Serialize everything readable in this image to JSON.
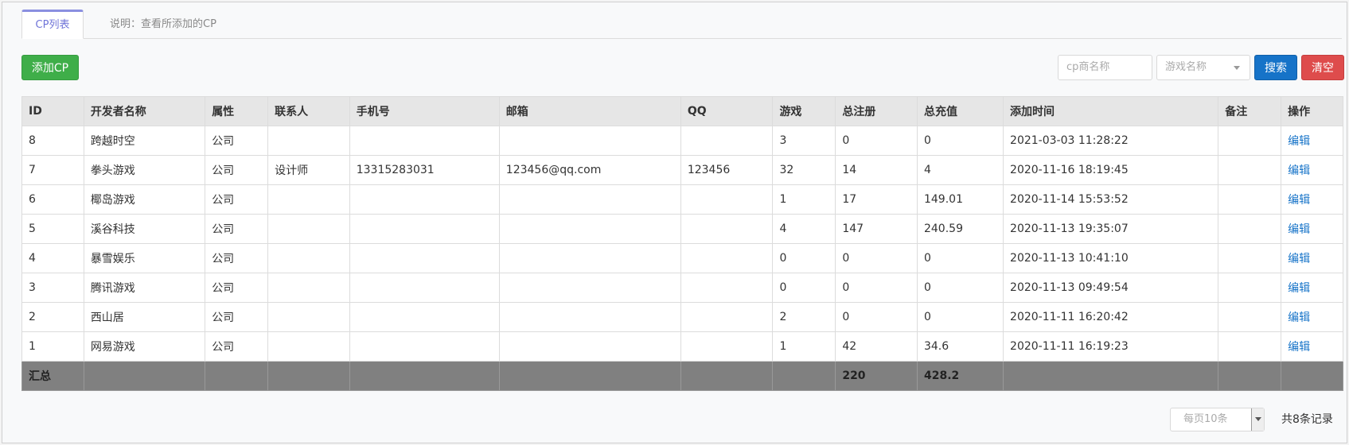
{
  "tabs": {
    "active_label": "CP列表",
    "description": "说明：查看所添加的CP"
  },
  "toolbar": {
    "add_label": "添加CP",
    "cp_name_placeholder": "cp商名称",
    "game_select_value": "游戏名称",
    "search_label": "搜索",
    "clear_label": "清空"
  },
  "table": {
    "headers": [
      "ID",
      "开发者名称",
      "属性",
      "联系人",
      "手机号",
      "邮箱",
      "QQ",
      "游戏",
      "总注册",
      "总充值",
      "添加时间",
      "备注",
      "操作"
    ],
    "rows": [
      {
        "id": "8",
        "name": "跨越时空",
        "attr": "公司",
        "contact": "",
        "phone": "",
        "email": "",
        "qq": "",
        "games": "3",
        "registrations": "0",
        "recharge": "0",
        "time": "2021-03-03 11:28:22",
        "note": "",
        "action": "编辑"
      },
      {
        "id": "7",
        "name": "拳头游戏",
        "attr": "公司",
        "contact": "设计师",
        "phone": "13315283031",
        "email": "123456@qq.com",
        "qq": "123456",
        "games": "32",
        "registrations": "14",
        "recharge": "4",
        "time": "2020-11-16 18:19:45",
        "note": "",
        "action": "编辑"
      },
      {
        "id": "6",
        "name": "椰岛游戏",
        "attr": "公司",
        "contact": "",
        "phone": "",
        "email": "",
        "qq": "",
        "games": "1",
        "registrations": "17",
        "recharge": "149.01",
        "time": "2020-11-14 15:53:52",
        "note": "",
        "action": "编辑"
      },
      {
        "id": "5",
        "name": "溪谷科技",
        "attr": "公司",
        "contact": "",
        "phone": "",
        "email": "",
        "qq": "",
        "games": "4",
        "registrations": "147",
        "recharge": "240.59",
        "time": "2020-11-13 19:35:07",
        "note": "",
        "action": "编辑"
      },
      {
        "id": "4",
        "name": "暴雪娱乐",
        "attr": "公司",
        "contact": "",
        "phone": "",
        "email": "",
        "qq": "",
        "games": "0",
        "registrations": "0",
        "recharge": "0",
        "time": "2020-11-13 10:41:10",
        "note": "",
        "action": "编辑"
      },
      {
        "id": "3",
        "name": "腾讯游戏",
        "attr": "公司",
        "contact": "",
        "phone": "",
        "email": "",
        "qq": "",
        "games": "0",
        "registrations": "0",
        "recharge": "0",
        "time": "2020-11-13 09:49:54",
        "note": "",
        "action": "编辑"
      },
      {
        "id": "2",
        "name": "西山居",
        "attr": "公司",
        "contact": "",
        "phone": "",
        "email": "",
        "qq": "",
        "games": "2",
        "registrations": "0",
        "recharge": "0",
        "time": "2020-11-11 16:20:42",
        "note": "",
        "action": "编辑"
      },
      {
        "id": "1",
        "name": "网易游戏",
        "attr": "公司",
        "contact": "",
        "phone": "",
        "email": "",
        "qq": "",
        "games": "1",
        "registrations": "42",
        "recharge": "34.6",
        "time": "2020-11-11 16:19:23",
        "note": "",
        "action": "编辑"
      }
    ],
    "summary": {
      "label": "汇总",
      "total_registrations": "220",
      "total_recharge": "428.2"
    }
  },
  "pager": {
    "page_size_value": "每页10条",
    "total_text": "共8条记录"
  },
  "colors": {
    "accent": "#6f74d8",
    "add": "#3fae49",
    "search": "#1673c8",
    "clear": "#de4c4c",
    "summary_bg": "#808080"
  }
}
